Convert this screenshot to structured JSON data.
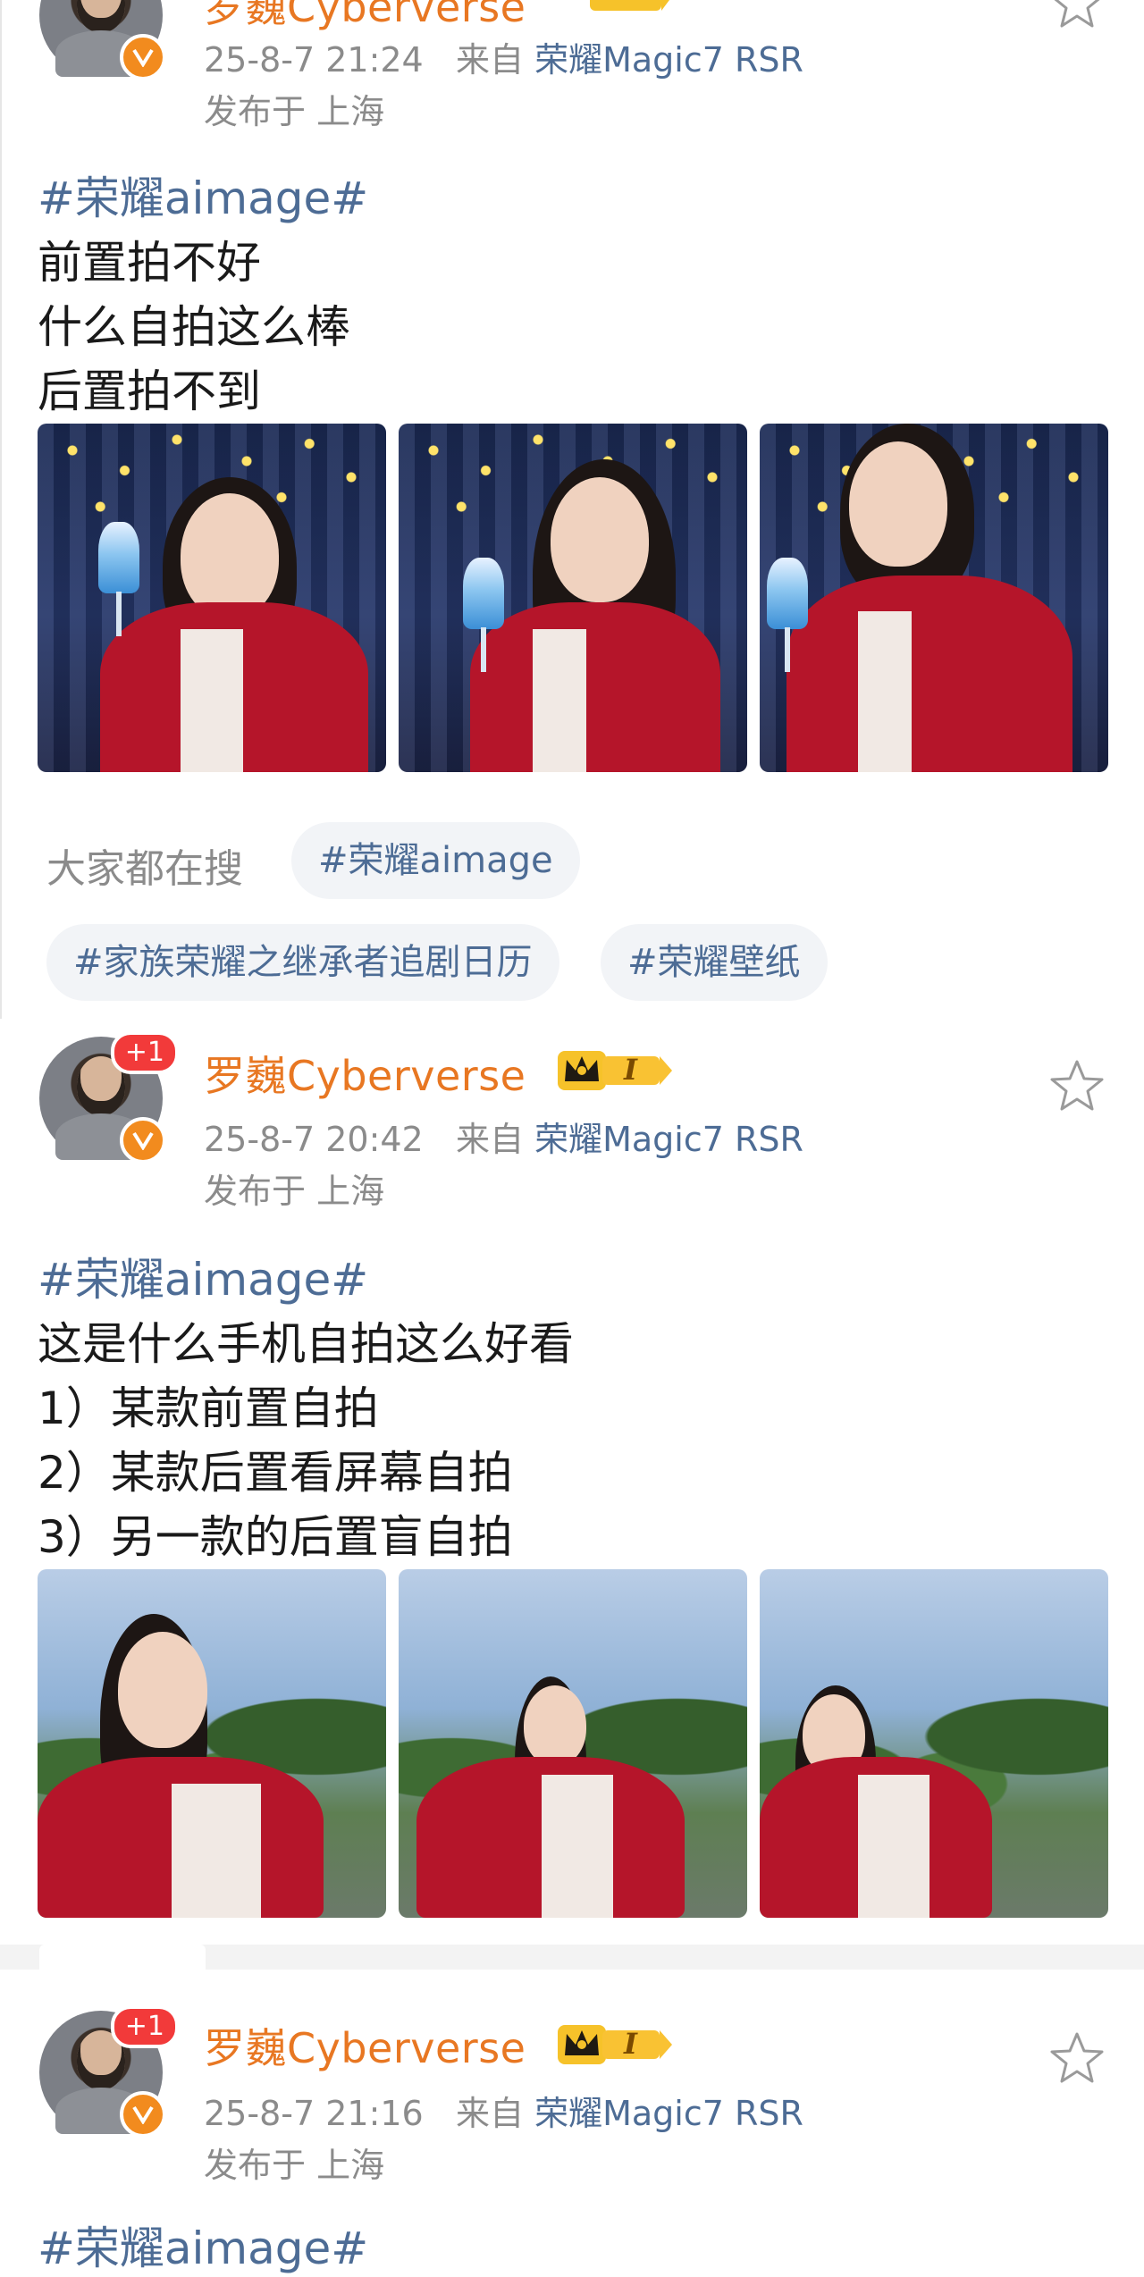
{
  "colors": {
    "username": "#e87722",
    "link": "#4d6c95",
    "meta": "#8b8b8b",
    "badge_orange": "#f28b1e",
    "badge_red": "#f23a3a"
  },
  "posts": [
    {
      "username": "罗巍Cyberverse",
      "time": "25-8-7 21:24",
      "from_label": "来自",
      "source": "荣耀Magic7 RSR",
      "location": "发布于 上海",
      "hashtag": "#荣耀aimage#",
      "lines": [
        "前置拍不好",
        "什么自拍这么棒",
        "后置拍不到"
      ],
      "images": [
        "selfie-indoor-1",
        "selfie-indoor-2",
        "selfie-indoor-3"
      ]
    },
    {
      "username": "罗巍Cyberverse",
      "plus_badge": "+1",
      "time": "25-8-7 20:42",
      "from_label": "来自",
      "source": "荣耀Magic7 RSR",
      "location": "发布于 上海",
      "hashtag": "#荣耀aimage#",
      "lines": [
        "这是什么手机自拍这么好看",
        "1）某款前置自拍",
        "2）某款后置看屏幕自拍",
        "3）另一款的后置盲自拍"
      ],
      "images": [
        "selfie-outdoor-1",
        "selfie-outdoor-2",
        "selfie-outdoor-3"
      ]
    },
    {
      "username": "罗巍Cyberverse",
      "plus_badge": "+1",
      "time": "25-8-7 21:16",
      "from_label": "来自",
      "source": "荣耀Magic7 RSR",
      "location": "发布于 上海",
      "hashtag": "#荣耀aimage#"
    }
  ],
  "search": {
    "label": "大家都在搜",
    "tags": [
      "#荣耀aimage",
      "#家族荣耀之继承者追剧日历",
      "#荣耀壁纸"
    ]
  },
  "badge": {
    "level": "I"
  },
  "icons": {
    "favorite": "star-outline-icon",
    "verified": "verified-v-icon",
    "crown": "crown-icon"
  }
}
